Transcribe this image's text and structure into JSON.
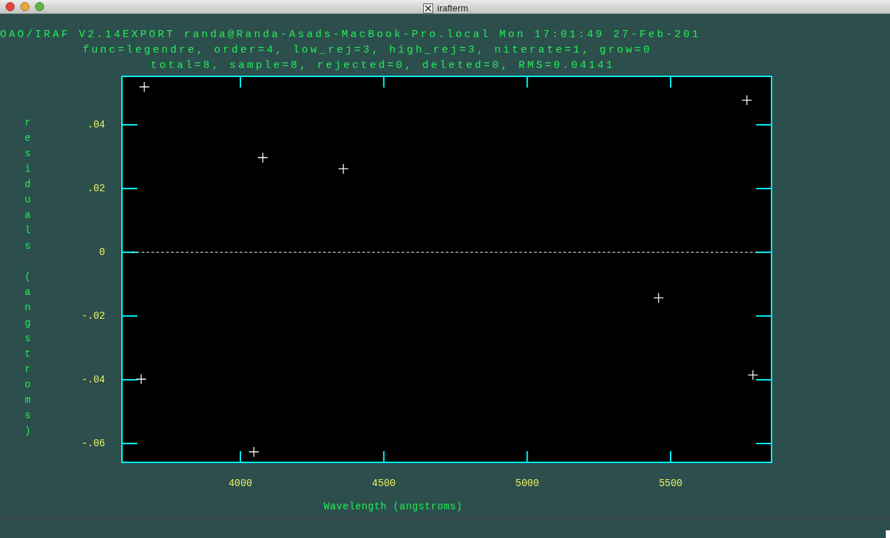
{
  "window": {
    "title": "irafterm"
  },
  "header": {
    "lines": [
      "OAO/IRAF V2.14EXPORT randa@Randa-Asads-MacBook-Pro.local Mon 17:01:49 27-Feb-201",
      "func=legendre, order=4, low_rej=3, high_rej=3, niterate=1, grow=0",
      "total=8, sample=8, rejected=0, deleted=0, RMS=0.04141"
    ]
  },
  "plot": {
    "chart_data": {
      "type": "scatter",
      "xlabel": "Wavelength (angstroms)",
      "ylabel": "residuals (angstroms)",
      "xlim": [
        3587,
        5852
      ],
      "ylim": [
        -0.0659,
        0.0552
      ],
      "xticks": [
        {
          "value": 4000,
          "label": "4000"
        },
        {
          "value": 4500,
          "label": "4500"
        },
        {
          "value": 5000,
          "label": "5000"
        },
        {
          "value": 5500,
          "label": "5500"
        }
      ],
      "yticks": [
        {
          "value": 0.04,
          "label": ".04"
        },
        {
          "value": 0.02,
          "label": ".02"
        },
        {
          "value": 0,
          "label": "0"
        },
        {
          "value": -0.02,
          "label": "-.02"
        },
        {
          "value": -0.04,
          "label": "-.04"
        },
        {
          "value": -0.06,
          "label": "-.06"
        }
      ],
      "ref_lines": [
        {
          "axis": "y",
          "value": 0,
          "color": "#ffffff"
        }
      ],
      "series": [
        {
          "color": "#ffffff",
          "x": [
            3665,
            4078,
            4359,
            5766,
            5458,
            5787,
            3654,
            4047
          ],
          "values": [
            0.0519,
            0.0297,
            0.0262,
            0.0477,
            -0.0143,
            -0.0385,
            -0.0398,
            -0.0626
          ]
        }
      ]
    }
  }
}
